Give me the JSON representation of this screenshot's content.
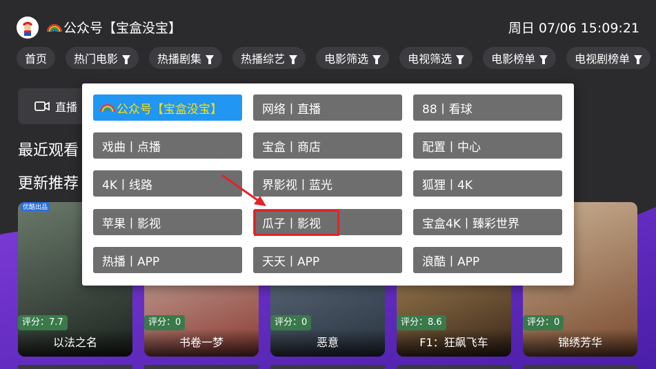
{
  "header": {
    "brand_text": "公众号【宝盒没宝】",
    "datetime": "周日 07/06 15:09:21"
  },
  "tabs": [
    {
      "label": "首页",
      "has_filter": false
    },
    {
      "label": "热门电影",
      "has_filter": true
    },
    {
      "label": "热播剧集",
      "has_filter": true
    },
    {
      "label": "热播综艺",
      "has_filter": true
    },
    {
      "label": "电影筛选",
      "has_filter": true
    },
    {
      "label": "电视筛选",
      "has_filter": true
    },
    {
      "label": "电影榜单",
      "has_filter": true
    },
    {
      "label": "电视剧榜单",
      "has_filter": true
    }
  ],
  "left_content": {
    "live_label": "直播",
    "recent_title": "最近观看",
    "recommend_title": "更新推荐"
  },
  "posters": [
    {
      "score": "评分：7.7",
      "title": "以法之名",
      "tag": "优酷出品",
      "colors": [
        "#6b7a6b",
        "#1d2420"
      ]
    },
    {
      "score": "评分：0",
      "title": "书卷一梦",
      "tag": "",
      "colors": [
        "#d9cbbd",
        "#8a3b34"
      ]
    },
    {
      "score": "评分：0",
      "title": "恶意",
      "tag": "",
      "colors": [
        "#6f7f91",
        "#2a3440"
      ]
    },
    {
      "score": "评分：8.6",
      "title": "F1：狂飙飞车",
      "tag": "",
      "colors": [
        "#c9a56b",
        "#3a2618"
      ]
    },
    {
      "score": "评分：0",
      "title": "锦绣芳华",
      "tag": "",
      "colors": [
        "#c9b093",
        "#7a4a2f"
      ]
    }
  ],
  "source_dialog": {
    "items": [
      [
        "公众号【宝盒没宝】",
        "网络丨直播",
        "88丨看球"
      ],
      [
        "戏曲丨点播",
        "宝盒丨商店",
        "配置丨中心"
      ],
      [
        "4K丨线路",
        "界影视丨蓝光",
        "狐狸丨4K"
      ],
      [
        "苹果丨影视",
        "瓜子丨影视",
        "宝盒4K丨臻彩世界"
      ],
      [
        "热播丨APP",
        "天天丨APP",
        "浪酷丨APP"
      ]
    ],
    "selected_item": "公众号【宝盒没宝】",
    "highlighted_item": "瓜子丨影视"
  },
  "colors": {
    "selected_bg": "#2196f3",
    "selected_text": "#ffe000",
    "item_bg": "#6e6e6e",
    "highlight_border": "#e0232a",
    "arrow": "#e0232a"
  }
}
